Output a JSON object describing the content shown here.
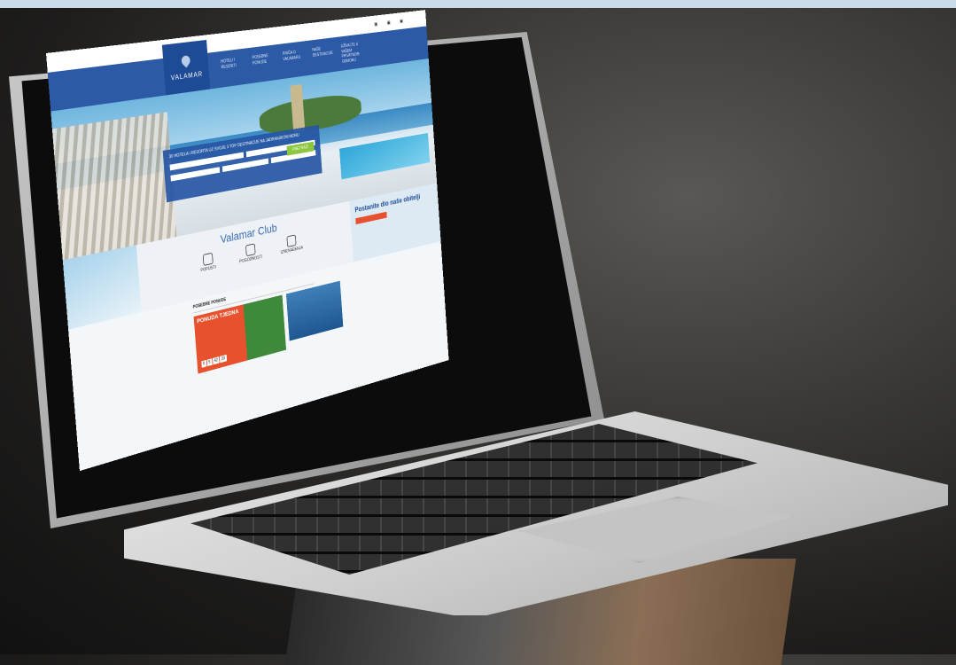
{
  "site": {
    "logo": "VALAMAR",
    "nav": [
      "HOTELI I RESORTI",
      "POSEBNE PONUDE",
      "PRIČA O VALAMARU",
      "NAŠE DESTINACIJE",
      "UŽIVAJTE U VAŠEM PRIVATNOM ODMORU"
    ],
    "booking_title": "30 HOTELA I RESORTA UZ SVOJE 3 TOP DESTINACIJE NA JADRANSKOM MORU",
    "booking_button": "PRETRAŽI",
    "club_name": "Valamar Club",
    "club_features": [
      "POPUSTI",
      "POGODNOSTI",
      "IZNENAĐENJA"
    ],
    "join_title": "Postanite dio naše obitelji",
    "offers_heading": "POSEBNE PONUDE",
    "offer1_title": "PONUDA TJEDNA",
    "offer1_countdown": [
      "0",
      "5",
      "42",
      "33"
    ]
  },
  "colors": {
    "brand_blue": "#2c5aa6",
    "accent_orange": "#e8512d",
    "accent_green": "#8dc63f"
  }
}
